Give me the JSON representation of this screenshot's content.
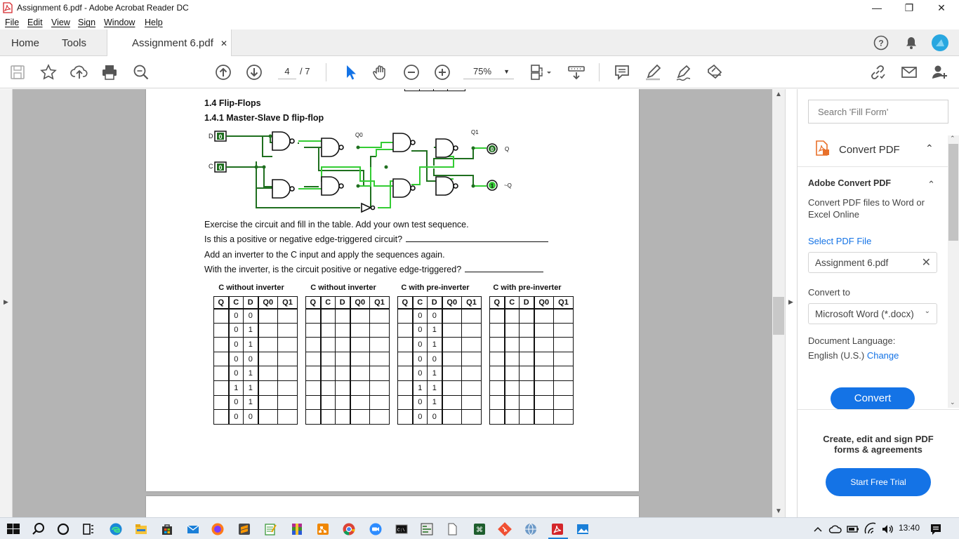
{
  "window": {
    "title": "Assignment 6.pdf - Adobe Acrobat Reader DC",
    "minimize_label": "—",
    "restore_label": "❐",
    "close_label": "✕"
  },
  "menu": [
    "File",
    "Edit",
    "View",
    "Sign",
    "Window",
    "Help"
  ],
  "tabs": {
    "home": "Home",
    "tools": "Tools",
    "document": "Assignment 6.pdf",
    "close": "✕"
  },
  "toolbar": {
    "page_current": "4",
    "page_total": "/ 7",
    "zoom": "75%",
    "icons": [
      "save-icon",
      "star-icon",
      "upload-icon",
      "print-icon",
      "search-zoom-icon",
      "page-up-icon",
      "page-down-icon",
      "select-cursor-icon",
      "hand-icon",
      "zoom-out-icon",
      "zoom-in-icon",
      "page-fit-icon",
      "scroll-mode-icon",
      "comment-icon",
      "highlight-icon",
      "sign-icon",
      "fill-sign-icon",
      "link-icon",
      "email-icon",
      "add-user-icon"
    ]
  },
  "document": {
    "section": "1.4    Flip-Flops",
    "subsection": "1.4.1    Master-Slave D flip-flop",
    "circuit": {
      "label_d": "D",
      "label_c": "C",
      "input_value": "0",
      "label_q0": "Q0",
      "label_q1": "Q1",
      "output_q_label": "Q",
      "output_q_value": "0",
      "output_nq_label": "~Q",
      "output_nq_value": "1"
    },
    "paragraphs": [
      "Exercise the circuit and fill in the table. Add your own test sequence.",
      "Is this a positive or negative edge-triggered circuit?",
      "Add an inverter to the C input and apply the sequences again.",
      "With the inverter, is the circuit positive or negative edge-triggered?"
    ],
    "tables": [
      {
        "caption": "C without inverter",
        "headers": [
          "Q",
          "C",
          "D",
          "Q0",
          "Q1"
        ],
        "rows": [
          [
            "",
            "0",
            "0",
            "",
            ""
          ],
          [
            "",
            "0",
            "1",
            "",
            ""
          ],
          [
            "",
            "0",
            "1",
            "",
            ""
          ],
          [
            "",
            "0",
            "0",
            "",
            ""
          ],
          [
            "",
            "0",
            "1",
            "",
            ""
          ],
          [
            "",
            "1",
            "1",
            "",
            ""
          ],
          [
            "",
            "0",
            "1",
            "",
            ""
          ],
          [
            "",
            "0",
            "0",
            "",
            ""
          ]
        ]
      },
      {
        "caption": "C without inverter",
        "headers": [
          "Q",
          "C",
          "D",
          "Q0",
          "Q1"
        ],
        "rows": [
          [
            "",
            "",
            "",
            "",
            ""
          ],
          [
            "",
            "",
            "",
            "",
            ""
          ],
          [
            "",
            "",
            "",
            "",
            ""
          ],
          [
            "",
            "",
            "",
            "",
            ""
          ],
          [
            "",
            "",
            "",
            "",
            ""
          ],
          [
            "",
            "",
            "",
            "",
            ""
          ],
          [
            "",
            "",
            "",
            "",
            ""
          ],
          [
            "",
            "",
            "",
            "",
            ""
          ]
        ]
      },
      {
        "caption": "C with pre-inverter",
        "headers": [
          "Q",
          "C",
          "D",
          "Q0",
          "Q1"
        ],
        "rows": [
          [
            "",
            "0",
            "0",
            "",
            ""
          ],
          [
            "",
            "0",
            "1",
            "",
            ""
          ],
          [
            "",
            "0",
            "1",
            "",
            ""
          ],
          [
            "",
            "0",
            "0",
            "",
            ""
          ],
          [
            "",
            "0",
            "1",
            "",
            ""
          ],
          [
            "",
            "1",
            "1",
            "",
            ""
          ],
          [
            "",
            "0",
            "1",
            "",
            ""
          ],
          [
            "",
            "0",
            "0",
            "",
            ""
          ]
        ]
      },
      {
        "caption": "C with pre-inverter",
        "headers": [
          "Q",
          "C",
          "D",
          "Q0",
          "Q1"
        ],
        "rows": [
          [
            "",
            "",
            "",
            "",
            ""
          ],
          [
            "",
            "",
            "",
            "",
            ""
          ],
          [
            "",
            "",
            "",
            "",
            ""
          ],
          [
            "",
            "",
            "",
            "",
            ""
          ],
          [
            "",
            "",
            "",
            "",
            ""
          ],
          [
            "",
            "",
            "",
            "",
            ""
          ],
          [
            "",
            "",
            "",
            "",
            ""
          ],
          [
            "",
            "",
            "",
            "",
            ""
          ]
        ]
      }
    ]
  },
  "right_panel": {
    "search_placeholder": "Search 'Fill Form'",
    "tool_title": "Convert PDF",
    "section_title": "Adobe Convert PDF",
    "description": "Convert PDF files to Word or Excel Online",
    "select_file_link": "Select PDF File",
    "selected_file": "Assignment 6.pdf",
    "convert_to_label": "Convert to",
    "convert_to_value": "Microsoft Word (*.docx)",
    "language_label": "Document Language:",
    "language_value": "English (U.S.)",
    "change_link": "Change",
    "convert_button": "Convert",
    "promo_text": "Create, edit and sign PDF forms & agreements",
    "trial_button": "Start Free Trial"
  },
  "taskbar": {
    "time": "13:40",
    "colors": {
      "accent": "#1473e6",
      "wire_dark": "#1f6f1f",
      "wire_light": "#33cc33"
    }
  }
}
